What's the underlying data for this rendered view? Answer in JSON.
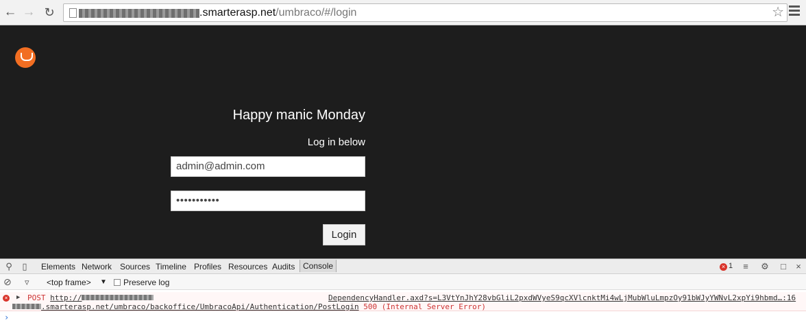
{
  "browser": {
    "url_host": ".smarterasp.net",
    "url_path": "/umbraco/#/login",
    "back_icon": "arrow-left",
    "forward_icon": "arrow-right",
    "reload_icon": "reload",
    "star_icon": "star",
    "menu_icon": "hamburger"
  },
  "login": {
    "greeting": "Happy manic Monday",
    "subtitle": "Log in below",
    "email_value": "admin@admin.com",
    "password_value": "•••••••••••",
    "login_button": "Login",
    "logo": "umbraco-logo",
    "brand_color": "#f26e22",
    "background_color": "#1d1d1d"
  },
  "devtools": {
    "tabs": [
      "Elements",
      "Network",
      "Sources",
      "Timeline",
      "Profiles",
      "Resources",
      "Audits",
      "Console"
    ],
    "active_tab": "Console",
    "error_count": "1",
    "frame_select": "<top frame>",
    "preserve_log": "Preserve log",
    "console": {
      "method": "POST",
      "url_start": "http://",
      "url_rest": ".smarterasp.net/umbraco/backoffice/UmbracoApi/Authentication/PostLogin",
      "status": "500 (Internal Server Error)",
      "source": "DependencyHandler.axd?s=L3VtYnJhY28vbGliL2pxdWVyeS9qcXVlcnktMi4wLjMubWluLmpzOy91bWJyYWNvL2xpYi9hbmd…:16"
    }
  }
}
